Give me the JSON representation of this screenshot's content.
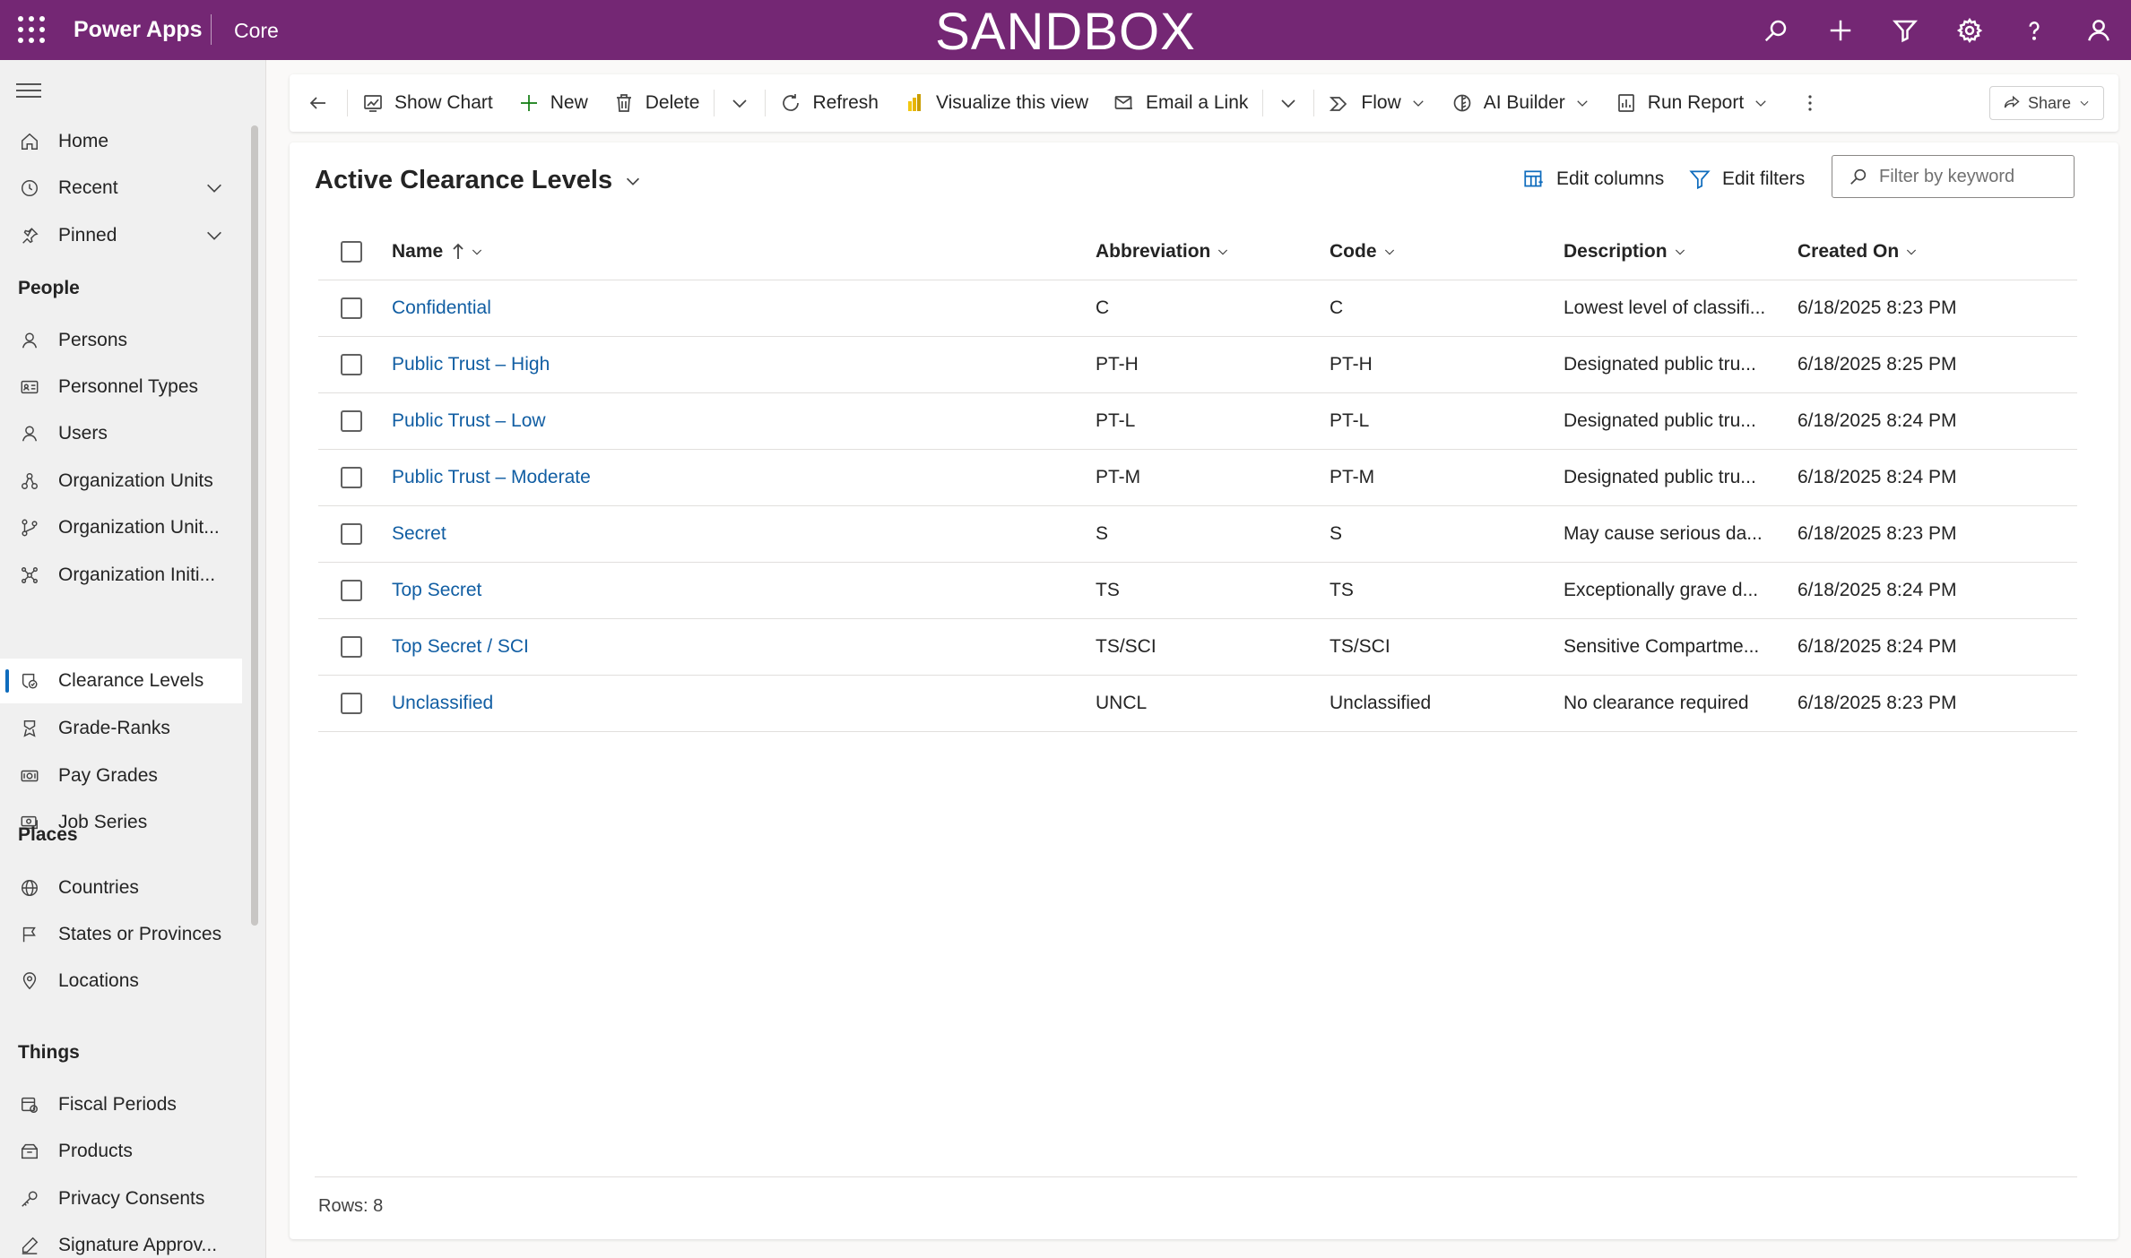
{
  "header": {
    "app_name": "Power Apps",
    "environment": "Core",
    "banner": "SANDBOX",
    "icons": [
      "search-icon",
      "add-icon",
      "filter-icon",
      "settings-icon",
      "help-icon",
      "user-icon"
    ]
  },
  "sidebar": {
    "items": [
      {
        "label": "Home",
        "icon": "home-icon"
      },
      {
        "label": "Recent",
        "icon": "clock-icon"
      },
      {
        "label": "Pinned",
        "icon": "pin-icon"
      }
    ],
    "groups": [
      {
        "title": "People",
        "items": [
          {
            "label": "Persons",
            "icon": "person-icon"
          },
          {
            "label": "Personnel Types",
            "icon": "contact-card-icon"
          },
          {
            "label": "Users",
            "icon": "person-icon"
          },
          {
            "label": "Organization Units",
            "icon": "org-icon"
          },
          {
            "label": "Organization Unit...",
            "icon": "branch-icon"
          },
          {
            "label": "Organization Initi...",
            "icon": "network-icon"
          },
          {
            "label": "Clearance Levels",
            "icon": "shield-badge-icon",
            "active": true
          },
          {
            "label": "Grade-Ranks",
            "icon": "ribbon-icon"
          },
          {
            "label": "Pay Grades",
            "icon": "money-icon"
          },
          {
            "label": "Job Series",
            "icon": "money-stack-icon"
          }
        ]
      },
      {
        "title": "Places",
        "items": [
          {
            "label": "Countries",
            "icon": "globe-icon"
          },
          {
            "label": "States or Provinces",
            "icon": "flag-icon"
          },
          {
            "label": "Locations",
            "icon": "location-icon"
          }
        ]
      },
      {
        "title": "Things",
        "items": [
          {
            "label": "Fiscal Periods",
            "icon": "calendar-icon"
          },
          {
            "label": "Products",
            "icon": "box-icon"
          },
          {
            "label": "Privacy Consents",
            "icon": "key-icon"
          },
          {
            "label": "Signature Approv...",
            "icon": "signature-icon"
          }
        ]
      }
    ]
  },
  "commandbar": {
    "show_chart": "Show Chart",
    "new": "New",
    "delete": "Delete",
    "refresh": "Refresh",
    "visualize": "Visualize this view",
    "email_link": "Email a Link",
    "flow": "Flow",
    "ai_builder": "AI Builder",
    "run_report": "Run Report",
    "share": "Share"
  },
  "view": {
    "title": "Active Clearance Levels",
    "edit_columns": "Edit columns",
    "edit_filters": "Edit filters",
    "search_placeholder": "Filter by keyword",
    "columns": [
      "Name",
      "Abbreviation",
      "Code",
      "Description",
      "Created On"
    ],
    "rows": [
      {
        "name": "Confidential",
        "abbreviation": "C",
        "code": "C",
        "description": "Lowest level of classifi...",
        "created_on": "6/18/2025 8:23 PM"
      },
      {
        "name": "Public Trust – High",
        "abbreviation": "PT-H",
        "code": "PT-H",
        "description": "Designated public tru...",
        "created_on": "6/18/2025 8:25 PM"
      },
      {
        "name": "Public Trust – Low",
        "abbreviation": "PT-L",
        "code": "PT-L",
        "description": "Designated public tru...",
        "created_on": "6/18/2025 8:24 PM"
      },
      {
        "name": "Public Trust – Moderate",
        "abbreviation": "PT-M",
        "code": "PT-M",
        "description": "Designated public tru...",
        "created_on": "6/18/2025 8:24 PM"
      },
      {
        "name": "Secret",
        "abbreviation": "S",
        "code": "S",
        "description": "May cause serious da...",
        "created_on": "6/18/2025 8:23 PM"
      },
      {
        "name": "Top Secret",
        "abbreviation": "TS",
        "code": "TS",
        "description": "Exceptionally grave d...",
        "created_on": "6/18/2025 8:24 PM"
      },
      {
        "name": "Top Secret / SCI",
        "abbreviation": "TS/SCI",
        "code": "TS/SCI",
        "description": "Sensitive Compartme...",
        "created_on": "6/18/2025 8:24 PM"
      },
      {
        "name": "Unclassified",
        "abbreviation": "UNCL",
        "code": "Unclassified",
        "description": "No clearance required",
        "created_on": "6/18/2025 8:23 PM"
      }
    ],
    "rows_count": "Rows: 8"
  },
  "colors": {
    "brand": "#742774",
    "link": "#115ea3",
    "accent": "#0f6cbd"
  }
}
